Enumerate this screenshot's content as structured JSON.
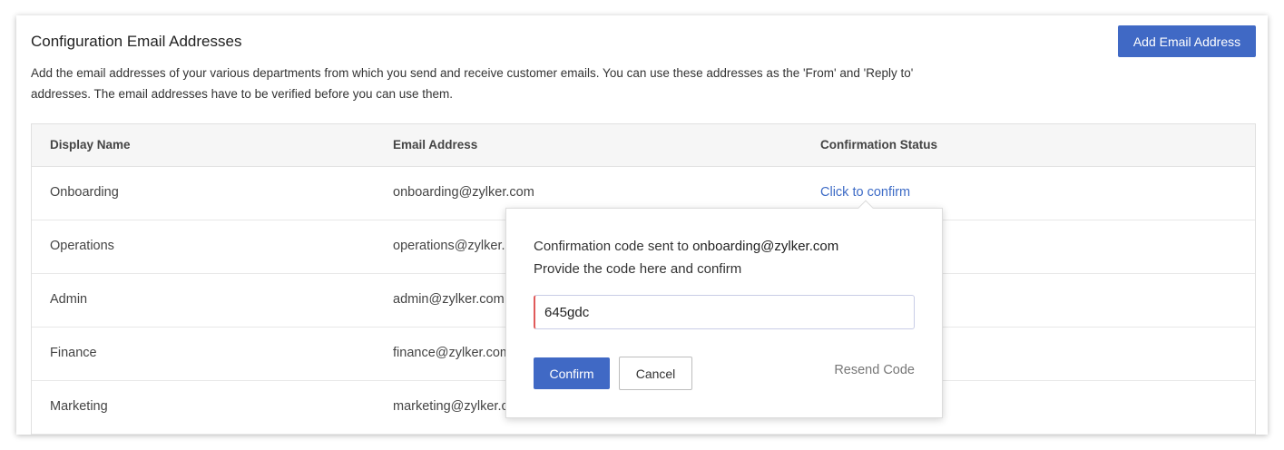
{
  "header": {
    "title": "Configuration Email Addresses",
    "add_button": "Add Email Address",
    "description": "Add the email addresses of your various departments from which you send and receive customer emails. You can use these addresses as the 'From' and 'Reply to' addresses. The email addresses have to be verified before you can use them."
  },
  "table": {
    "columns": [
      "Display Name",
      "Email Address",
      "Confirmation Status"
    ],
    "rows": [
      {
        "name": "Onboarding",
        "email": "onboarding@zylker.com",
        "status": "Click to confirm"
      },
      {
        "name": "Operations",
        "email": "operations@zylker.com",
        "status": ""
      },
      {
        "name": "Admin",
        "email": "admin@zylker.com",
        "status": ""
      },
      {
        "name": "Finance",
        "email": "finance@zylker.com",
        "status": ""
      },
      {
        "name": "Marketing",
        "email": "marketing@zylker.com",
        "status": ""
      }
    ]
  },
  "popover": {
    "sent_prefix": "Confirmation code sent to ",
    "sent_email": "onboarding@zylker.com",
    "instruction": "Provide the code here and confirm",
    "code_value": "645gdc",
    "confirm_label": "Confirm",
    "cancel_label": "Cancel",
    "resend_label": "Resend Code"
  },
  "colors": {
    "primary": "#4069c5",
    "link": "#3d6bc6",
    "input_error_accent": "#e05a5a"
  }
}
